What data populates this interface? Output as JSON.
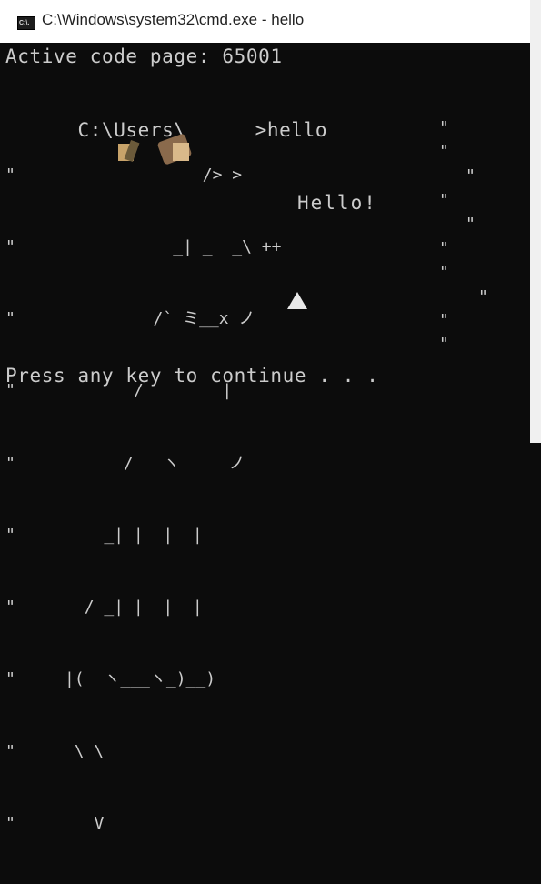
{
  "window": {
    "title": "C:\\Windows\\system32\\cmd.exe - hello",
    "icon_label": "C:\\."
  },
  "console": {
    "line1": "Active code page: 65001",
    "prompt": "C:\\Users\\",
    "prompt_tail": ">hello",
    "art_lines": [
      "\"                   /> >",
      "\"                _| _  _\\ ++",
      "\"              /` ミ__x ノ",
      "\"            /        |",
      "\"           /   ヽ     ノ",
      "\"         _| |  |  |",
      "\"       / _| |  |  |",
      "\"     |(  ヽ___ヽ_)__)",
      "\"      \\ \\",
      "\"        V"
    ],
    "right_quotes": [
      "\"",
      "\"",
      "\"",
      "\"",
      "\"",
      "\"",
      "\"",
      "\"",
      "\"",
      "\""
    ],
    "hello": "Hello!",
    "footer": "Press any key to continue . . ."
  },
  "colors": {
    "console_bg": "#0c0c0c",
    "console_fg": "#cccccc",
    "titlebar_bg": "#ffffff"
  },
  "icons": {
    "app": "cmd-icon",
    "triangle": "triangle-up-icon"
  }
}
